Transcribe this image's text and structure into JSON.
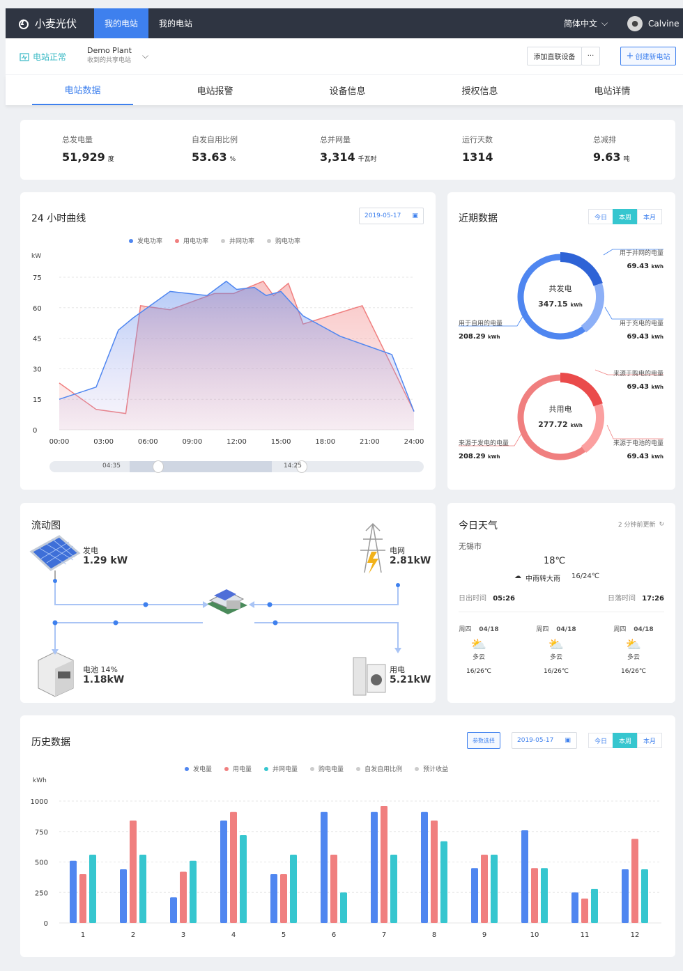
{
  "nav": {
    "logo": "小麦光伏",
    "items": [
      "我的电站",
      "我的电站"
    ],
    "lang": "简体中文",
    "user": "Calvine"
  },
  "plantbar": {
    "status": "电站正常",
    "plant_name": "Demo Plant",
    "plant_sub": "收到的共享电站",
    "add_device": "添加直联设备",
    "more": "···",
    "create": "创建新电站"
  },
  "tabs": [
    "电站数据",
    "电站报警",
    "设备信息",
    "授权信息",
    "电站详情"
  ],
  "kpis": [
    {
      "label": "总发电量",
      "value": "51,929",
      "unit": "度"
    },
    {
      "label": "自发自用比例",
      "value": "53.63",
      "unit": "%"
    },
    {
      "label": "总并网量",
      "value": "3,314",
      "unit": "千瓦时"
    },
    {
      "label": "运行天数",
      "value": "1314",
      "unit": ""
    },
    {
      "label": "总减排",
      "value": "9.63",
      "unit": "吨"
    }
  ],
  "curve": {
    "title": "24 小时曲线",
    "date": "2019-05-17",
    "legend": [
      "发电功率",
      "用电功率",
      "并网功率",
      "购电功率"
    ],
    "unit": "kW",
    "range_start": "04:35",
    "range_end": "14:25"
  },
  "recent": {
    "title": "近期数据",
    "seg": [
      "今日",
      "本周",
      "本月"
    ],
    "gen": {
      "center_label": "共发电",
      "center_value": "347.15",
      "unit": "kWh",
      "l1": "用于并网的电量",
      "v1": "69.43",
      "l2": "用于自用的电量",
      "v2": "208.29",
      "l3": "用于充电的电量",
      "v3": "69.43"
    },
    "use": {
      "center_label": "共用电",
      "center_value": "277.72",
      "unit": "kWh",
      "l1": "来源于购电的电量",
      "v1": "69.43",
      "l2": "来源于发电的电量",
      "v2": "208.29",
      "l3": "来源于电池的电量",
      "v3": "69.43"
    }
  },
  "flow": {
    "title": "流动图",
    "gen_label": "发电",
    "gen_value": "1.29 kW",
    "grid_label": "电网",
    "grid_value": "2.81kW",
    "batt_label": "电池 14%",
    "batt_value": "1.18kW",
    "load_label": "用电",
    "load_value": "5.21kW"
  },
  "weather": {
    "title": "今日天气",
    "updated": "2 分钟前更新",
    "city": "无锡市",
    "temp": "18℃",
    "desc": "中雨转大雨",
    "range": "16/24℃",
    "sunrise_label": "日出时间",
    "sunrise": "05:26",
    "sunset_label": "日落时间",
    "sunset": "17:26",
    "days": [
      {
        "day": "周四",
        "date": "04/18",
        "desc": "多云",
        "range": "16/26℃"
      },
      {
        "day": "周四",
        "date": "04/18",
        "desc": "多云",
        "range": "16/26℃"
      },
      {
        "day": "周四",
        "date": "04/18",
        "desc": "多云",
        "range": "16/26℃"
      }
    ]
  },
  "history": {
    "title": "历史数据",
    "param": "参数选择",
    "date": "2019-05-17",
    "seg": [
      "今日",
      "本周",
      "本月"
    ],
    "unit": "kWh",
    "legend": [
      "发电量",
      "用电量",
      "并网电量",
      "购电电量",
      "自发自用比例",
      "预计收益"
    ]
  },
  "colors": {
    "gen": "#4f86f0",
    "use": "#f07f7f",
    "grid": "#36c6cf",
    "buy": "#cccccc"
  },
  "chart_data": [
    {
      "type": "area",
      "title": "24 小时曲线",
      "ylabel": "kW",
      "ylim": [
        0,
        75
      ],
      "yticks": [
        0,
        15,
        30,
        45,
        60,
        75
      ],
      "x": [
        "00:00",
        "03:00",
        "06:00",
        "09:00",
        "12:00",
        "15:00",
        "18:00",
        "21:00",
        "24:00"
      ],
      "series": [
        {
          "name": "发电功率",
          "points": [
            [
              0,
              15
            ],
            [
              2.5,
              21
            ],
            [
              4,
              49
            ],
            [
              5,
              55
            ],
            [
              7.5,
              68
            ],
            [
              10,
              66
            ],
            [
              11.3,
              73
            ],
            [
              12,
              69
            ],
            [
              13.2,
              70
            ],
            [
              14,
              66
            ],
            [
              15,
              68
            ],
            [
              16.5,
              56
            ],
            [
              19,
              46
            ],
            [
              22.5,
              37
            ],
            [
              24,
              9
            ]
          ]
        },
        {
          "name": "用电功率",
          "points": [
            [
              0,
              23
            ],
            [
              2.5,
              10
            ],
            [
              4.5,
              8
            ],
            [
              5.5,
              61
            ],
            [
              7.5,
              59
            ],
            [
              10.5,
              67
            ],
            [
              11.8,
              67
            ],
            [
              13.8,
              73
            ],
            [
              14.5,
              66
            ],
            [
              15.5,
              72
            ],
            [
              16.5,
              52
            ],
            [
              20.5,
              61
            ],
            [
              24,
              9
            ]
          ]
        }
      ]
    },
    {
      "type": "pie",
      "title": "共发电",
      "categories": [
        "用于并网的电量",
        "用于充电的电量",
        "用于自用的电量"
      ],
      "values": [
        69.43,
        69.43,
        208.29
      ]
    },
    {
      "type": "pie",
      "title": "共用电",
      "categories": [
        "来源于购电的电量",
        "来源于电池的电量",
        "来源于发电的电量"
      ],
      "values": [
        69.43,
        69.43,
        208.29
      ]
    },
    {
      "type": "bar",
      "title": "历史数据",
      "ylabel": "kWh",
      "ylim": [
        0,
        1000
      ],
      "yticks": [
        0,
        250,
        500,
        750,
        1000
      ],
      "categories": [
        "1",
        "2",
        "3",
        "4",
        "5",
        "6",
        "7",
        "8",
        "9",
        "10",
        "11",
        "12"
      ],
      "series": [
        {
          "name": "发电量",
          "values": [
            510,
            440,
            210,
            840,
            400,
            910,
            910,
            910,
            450,
            760,
            250,
            440
          ]
        },
        {
          "name": "用电量",
          "values": [
            400,
            840,
            420,
            910,
            400,
            560,
            960,
            840,
            560,
            450,
            200,
            690
          ]
        },
        {
          "name": "并网电量",
          "values": [
            560,
            560,
            510,
            720,
            560,
            250,
            560,
            670,
            560,
            450,
            280,
            440
          ]
        }
      ]
    }
  ]
}
